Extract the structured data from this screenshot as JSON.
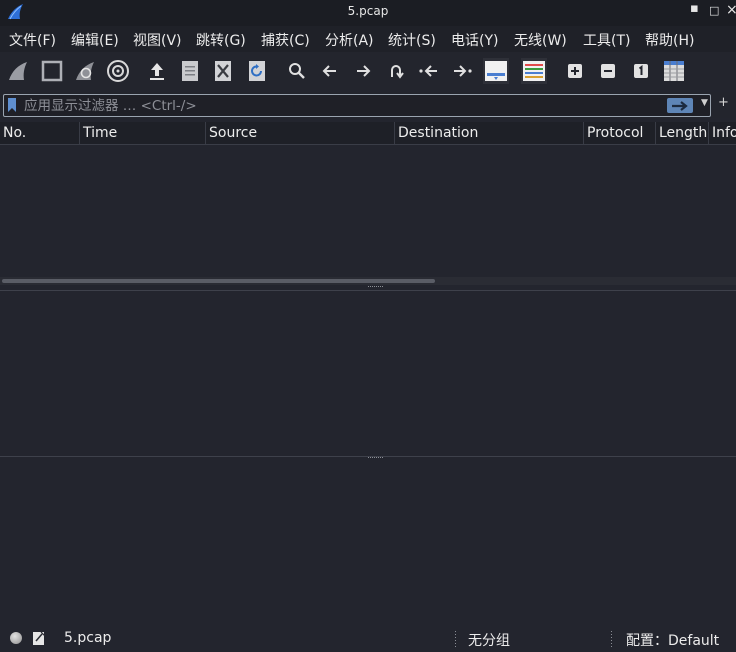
{
  "window": {
    "title": "5.pcap",
    "minimize": "▪",
    "maximize": "□",
    "close": "×"
  },
  "menu": [
    "文件(F)",
    "编辑(E)",
    "视图(V)",
    "跳转(G)",
    "捕获(C)",
    "分析(A)",
    "统计(S)",
    "电话(Y)",
    "无线(W)",
    "工具(T)",
    "帮助(H)"
  ],
  "filter": {
    "placeholder": "应用显示过滤器 … <Ctrl-/>",
    "plus": "+"
  },
  "columns": [
    "No.",
    "Time",
    "Source",
    "Destination",
    "Protocol",
    "Length",
    "Info"
  ],
  "status": {
    "file": "5.pcap",
    "group": "无分组",
    "profile": "配置：Default"
  },
  "colors": {
    "accent": "#5e85b6",
    "background": "#23252e"
  }
}
